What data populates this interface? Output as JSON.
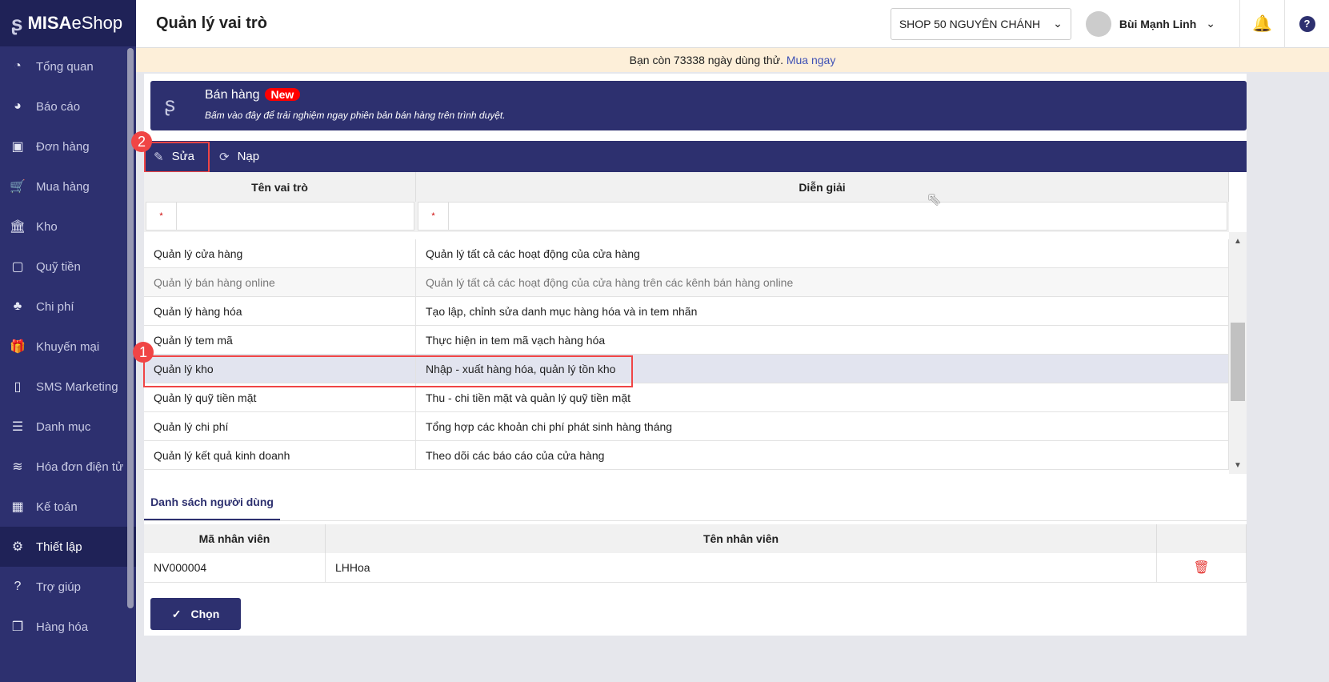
{
  "app": {
    "logo": "MISA eShop",
    "logo_main": "MISA",
    "logo_sub": "eShop"
  },
  "sidebar": {
    "items": [
      {
        "label": "Tổng quan",
        "icon": "dashboard-icon",
        "glyph": "◔"
      },
      {
        "label": "Báo cáo",
        "icon": "pie-chart-icon",
        "glyph": "◕"
      },
      {
        "label": "Đơn hàng",
        "icon": "truck-icon",
        "glyph": "▣"
      },
      {
        "label": "Mua hàng",
        "icon": "cart-icon",
        "glyph": "🛒"
      },
      {
        "label": "Kho",
        "icon": "warehouse-icon",
        "glyph": "🏛"
      },
      {
        "label": "Quỹ tiền",
        "icon": "safe-icon",
        "glyph": "▢"
      },
      {
        "label": "Chi phí",
        "icon": "money-bag-icon",
        "glyph": "♣"
      },
      {
        "label": "Khuyến mại",
        "icon": "gift-icon",
        "glyph": "🎁"
      },
      {
        "label": "SMS Marketing",
        "icon": "phone-icon",
        "glyph": "▯"
      },
      {
        "label": "Danh mục",
        "icon": "list-icon",
        "glyph": "☰"
      },
      {
        "label": "Hóa đơn điện tử",
        "icon": "invoice-icon",
        "glyph": "≋"
      },
      {
        "label": "Kế toán",
        "icon": "calculator-icon",
        "glyph": "▦"
      },
      {
        "label": "Thiết lập",
        "icon": "gear-icon",
        "glyph": "⚙"
      },
      {
        "label": "Trợ giúp",
        "icon": "help-icon",
        "glyph": "?"
      },
      {
        "label": "Hàng hóa",
        "icon": "boxes-icon",
        "glyph": "❒"
      }
    ],
    "active": "Thiết lập"
  },
  "header": {
    "title": "Quản lý vai trò",
    "shop": "SHOP 50 NGUYÊN CHÁNH",
    "user": "Bùi Mạnh Linh"
  },
  "trial": {
    "text": "Bạn còn 73338 ngày dùng thử.",
    "link": "Mua ngay"
  },
  "banner": {
    "title": "Bán hàng",
    "badge": "New",
    "subtitle": "Bấm vào đây để trải nghiệm ngay phiên bản bán hàng trên trình duyệt."
  },
  "toolbar": {
    "edit": "Sửa",
    "reload": "Nạp"
  },
  "annotations": {
    "one": "1",
    "two": "2"
  },
  "roles": {
    "columns": [
      "Tên vai trò",
      "Diễn giải"
    ],
    "required_mark": "*",
    "rows": [
      [
        "Quản lý cửa hàng",
        "Quản lý tất cả các hoạt động của cửa hàng"
      ],
      [
        "Quản lý bán hàng online",
        "Quản lý tất cả các hoạt động của cửa hàng trên các kênh bán hàng online"
      ],
      [
        "Quản lý hàng hóa",
        "Tạo lập, chỉnh sửa danh mục hàng hóa và in tem nhãn"
      ],
      [
        "Quản lý tem mã",
        "Thực hiện in tem mã vạch hàng hóa"
      ],
      [
        "Quản lý kho",
        "Nhập - xuất hàng hóa, quản lý tồn kho"
      ],
      [
        "Quản lý quỹ tiền mặt",
        "Thu - chi tiền mặt và quản lý quỹ tiền mặt"
      ],
      [
        "Quản lý chi phí",
        "Tổng hợp các khoản chi phí phát sinh hàng tháng"
      ],
      [
        "Quản lý kết quả kinh doanh",
        "Theo dõi các báo cáo của cửa hàng"
      ]
    ],
    "selected_index": 4
  },
  "users": {
    "tab": "Danh sách người dùng",
    "columns": [
      "Mã nhân viên",
      "Tên nhân viên"
    ],
    "rows": [
      [
        "NV000004",
        "LHHoa"
      ]
    ]
  },
  "actions": {
    "choose": "Chọn"
  }
}
